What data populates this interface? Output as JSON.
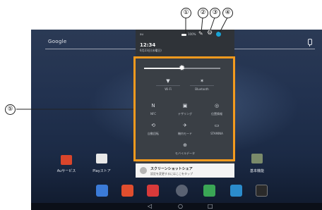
{
  "home": {
    "search_label": "Google",
    "apps": [
      {
        "label": "Auサービス",
        "icon": "au-services-icon"
      },
      {
        "label": "Playストア",
        "icon": "play-store-icon"
      },
      {
        "label": "基本機能",
        "icon": "basic-functions-icon"
      }
    ],
    "dock_icons": [
      "browser-icon",
      "mail-icon",
      "contacts-icon",
      "app-drawer-icon",
      "maps-icon",
      "tv-icon",
      "camera-icon"
    ]
  },
  "navbar": {
    "back": "◁",
    "home": "○",
    "recents": "□"
  },
  "shade": {
    "carrier": "au",
    "battery_text": "100%",
    "time": "12:34",
    "date": "6月23日(水曜日)",
    "brightness_fraction": 0.5,
    "tiles": [
      {
        "label": "Wi-Fi",
        "glyph": "▼"
      },
      {
        "label": "Bluetooth",
        "glyph": "✶"
      },
      {
        "label": "NFC",
        "glyph": "N"
      },
      {
        "label": "テザリング",
        "glyph": "▣"
      },
      {
        "label": "位置情報",
        "glyph": "◎"
      },
      {
        "label": "自動回転",
        "glyph": "⟲"
      },
      {
        "label": "機内モード",
        "glyph": "✈"
      },
      {
        "label": "STAMINA",
        "glyph": "▭"
      },
      {
        "label": "モバイルデータ",
        "glyph": "⊕"
      }
    ]
  },
  "notification": {
    "title": "スクリーンショットシェア",
    "text": "設定を変更するにはここをタップ"
  },
  "callouts": {
    "c1": "①",
    "c2": "②",
    "c3": "③",
    "c4": "④",
    "c5": "⑤"
  },
  "colors": {
    "highlight": "#f39a1e",
    "user_icon": "#18a4d6"
  }
}
